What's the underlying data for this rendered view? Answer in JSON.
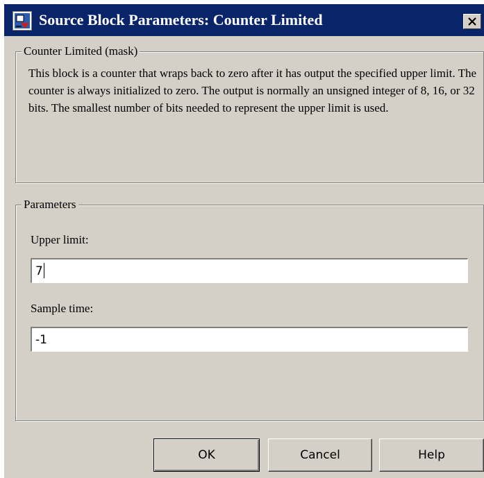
{
  "window": {
    "title": "Source Block Parameters: Counter Limited",
    "close_label": "×"
  },
  "mask_group": {
    "label": "Counter Limited (mask)",
    "description": "This block is a counter that wraps back to zero after it has output the specified upper limit.  The counter is always initialized to zero.  The output is normally an unsigned integer of 8, 16, or 32 bits. The smallest number of bits needed to represent the upper limit is used."
  },
  "parameters_group": {
    "label": "Parameters",
    "fields": [
      {
        "label": "Upper limit:",
        "value": "7"
      },
      {
        "label": "Sample time:",
        "value": "-1"
      }
    ]
  },
  "buttons": {
    "ok": "OK",
    "cancel": "Cancel",
    "help": "Help"
  },
  "colors": {
    "titlebar": "#0a246a",
    "dialog_background": "#d4d0c8"
  },
  "icons": {
    "title": "simulink-block-icon",
    "close": "close-icon"
  }
}
